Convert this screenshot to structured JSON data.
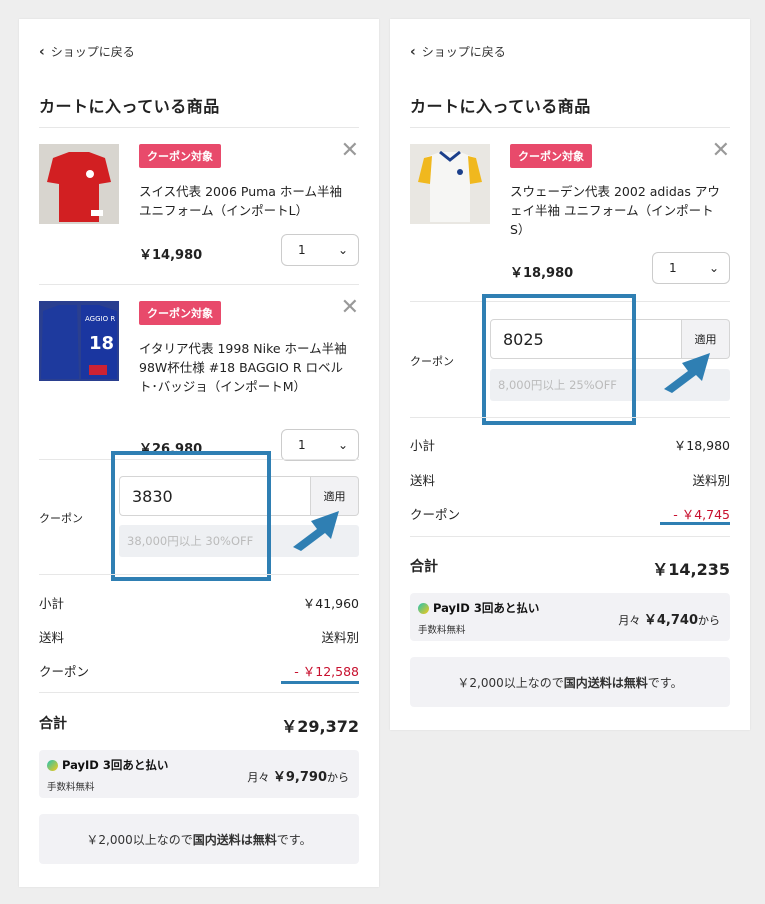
{
  "colors": {
    "badge": "#e84a6b",
    "accent": "#2f7fb3",
    "negative": "#c8102e"
  },
  "left": {
    "back_label": "ショップに戻る",
    "title": "カートに入っている商品",
    "items": [
      {
        "badge": "クーポン対象",
        "name": "スイス代表 2006 Puma ホーム半袖 ユニフォーム（インポートL）",
        "price": "￥14,980",
        "qty": "1"
      },
      {
        "badge": "クーポン対象",
        "name": "イタリア代表 1998 Nike ホーム半袖 98W杯仕様 #18 BAGGIO R ロベルト･バッジョ（インポートM）",
        "price": "￥26,980",
        "qty": "1"
      }
    ],
    "coupon": {
      "label": "クーポン",
      "value": "3830",
      "apply": "適用",
      "hint": "38,000円以上 30%OFF"
    },
    "summary": {
      "subtotal_label": "小計",
      "subtotal": "￥41,960",
      "shipping_label": "送料",
      "shipping": "送料別",
      "coupon_label": "クーポン",
      "coupon": "- ￥12,588"
    },
    "total": {
      "label": "合計",
      "value": "￥29,372"
    },
    "payid": {
      "brand": "PayID 3回あと払い",
      "fee": "手数料無料",
      "prefix": "月々",
      "amount": "￥9,790",
      "suffix": "から"
    },
    "notice": {
      "pre": "￥2,000以上なので",
      "bold": "国内送料は無料",
      "post": "です。"
    }
  },
  "right": {
    "back_label": "ショップに戻る",
    "title": "カートに入っている商品",
    "items": [
      {
        "badge": "クーポン対象",
        "name": "スウェーデン代表 2002 adidas アウェイ半袖 ユニフォーム（インポートS）",
        "price": "￥18,980",
        "qty": "1"
      }
    ],
    "coupon": {
      "label": "クーポン",
      "value": "8025",
      "apply": "適用",
      "hint": "8,000円以上 25%OFF"
    },
    "summary": {
      "subtotal_label": "小計",
      "subtotal": "￥18,980",
      "shipping_label": "送料",
      "shipping": "送料別",
      "coupon_label": "クーポン",
      "coupon": "- ￥4,745"
    },
    "total": {
      "label": "合計",
      "value": "￥14,235"
    },
    "payid": {
      "brand": "PayID 3回あと払い",
      "fee": "手数料無料",
      "prefix": "月々",
      "amount": "￥4,740",
      "suffix": "から"
    },
    "notice": {
      "pre": "￥2,000以上なので",
      "bold": "国内送料は無料",
      "post": "です。"
    }
  }
}
